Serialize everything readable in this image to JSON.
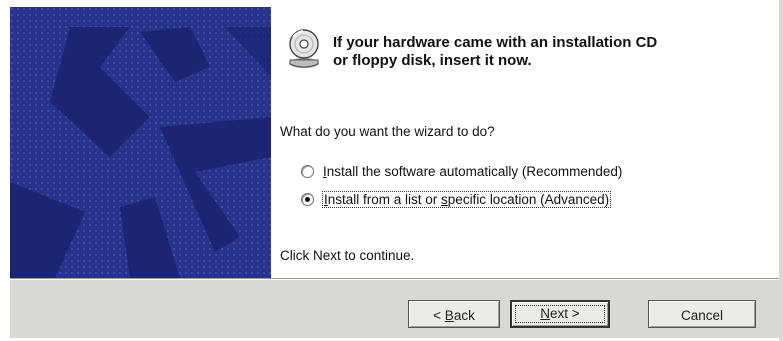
{
  "colors": {
    "banner_bg": "#27328a",
    "banner_dots": "#5a62b8",
    "button_bar": "#d9d8d3"
  },
  "header": {
    "icon": "cd-disk-icon",
    "headline_line1": "If your hardware came with an installation CD",
    "headline_line2": "or floppy disk, insert it now."
  },
  "main": {
    "question": "What do you want the wizard to do?",
    "options": [
      {
        "mnemonic": "I",
        "label_rest": "nstall the software automatically (Recommended)",
        "selected": false
      },
      {
        "mnemonic": "I",
        "label_pre": "nstall from a list or ",
        "mnemonic2": "s",
        "label_post": "pecific location (Advanced)",
        "selected": true
      }
    ],
    "footer": "Click Next to continue."
  },
  "buttons": {
    "back_pre": "< ",
    "back_mnemonic": "B",
    "back_rest": "ack",
    "next_mnemonic": "N",
    "next_rest": "ext >",
    "cancel": "Cancel"
  }
}
